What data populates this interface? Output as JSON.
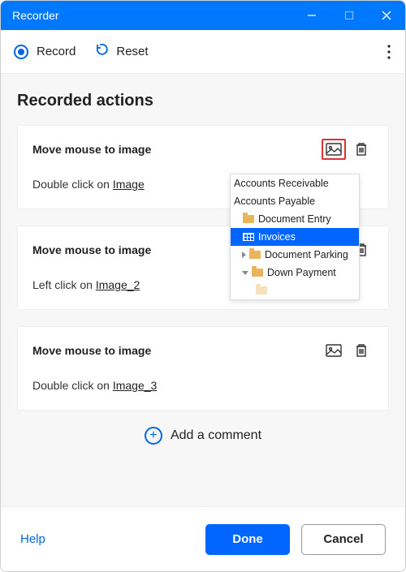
{
  "window": {
    "title": "Recorder"
  },
  "toolbar": {
    "record": "Record",
    "reset": "Reset"
  },
  "section_title": "Recorded actions",
  "actions": [
    {
      "title": "Move mouse to image",
      "sub_prefix": "Double click on  ",
      "link": "Image",
      "highlight": true
    },
    {
      "title": "Move mouse to image",
      "sub_prefix": "Left click on  ",
      "link": "Image_2",
      "highlight": false
    },
    {
      "title": "Move mouse to image",
      "sub_prefix": "Double click on  ",
      "link": "Image_3",
      "highlight": false
    }
  ],
  "popup": {
    "items": [
      {
        "label": "Accounts Receivable",
        "level": 0,
        "icon": "none"
      },
      {
        "label": "Accounts Payable",
        "level": 0,
        "icon": "none"
      },
      {
        "label": "Document Entry",
        "level": 1,
        "icon": "folder"
      },
      {
        "label": "Invoices",
        "level": 2,
        "icon": "grid",
        "selected": true
      },
      {
        "label": "Document Parking",
        "level": 1,
        "icon": "folder",
        "arrow": "right"
      },
      {
        "label": "Down Payment",
        "level": 1,
        "icon": "folder",
        "arrow": "down"
      }
    ]
  },
  "add_comment": "Add a comment",
  "footer": {
    "help": "Help",
    "done": "Done",
    "cancel": "Cancel"
  }
}
